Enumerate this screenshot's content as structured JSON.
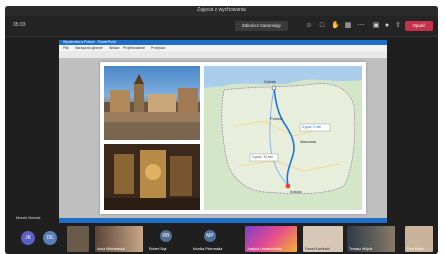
{
  "window": {
    "title": "Zajęcia z wychowania"
  },
  "toolbar": {
    "timer": "35:03",
    "live_button": "Zakończ transmisję",
    "leave_label": "Opuść",
    "icons": [
      "people-icon",
      "chat-icon",
      "raise-hand-icon",
      "view-icon",
      "more-icon",
      "camera-icon",
      "mic-icon",
      "share-icon"
    ]
  },
  "presentation": {
    "app_title": "Wycieczka w Polsce - PowerPoint",
    "menu": [
      "Plik",
      "Narzędzia główne",
      "Wstaw",
      "Projektowanie",
      "Przejścia",
      "Animacje",
      "Pokaz slajdów",
      "Recenzja",
      "Widok"
    ],
    "map": {
      "country_label": "Polska",
      "cities": [
        "Gdańsk",
        "Warszawa",
        "Kraków"
      ],
      "route_label_1": "6 godz. 2 min",
      "route_label_2": "4 godz. 34 min"
    }
  },
  "presenter": {
    "name": "Marek Nowak"
  },
  "participants": [
    {
      "initials": "JK",
      "color": "#5b5fc7"
    },
    {
      "initials": "DE",
      "color": "#5a7fb8"
    },
    {
      "name": "Anna Wiśniewska"
    },
    {
      "name": "Katarzyna Zielińska"
    },
    {
      "initials": "RB",
      "color": "#4f6f8f",
      "name": "Robert Bąk"
    },
    {
      "initials": "MP",
      "color": "#4a6e9a",
      "name": "Monika Piotrowska"
    },
    {
      "name": "Justyna Lewandowska"
    },
    {
      "name": "Paweł Kamiński"
    },
    {
      "name": "Tomasz Wójcik"
    },
    {
      "name": "Ewa Mazur"
    }
  ]
}
